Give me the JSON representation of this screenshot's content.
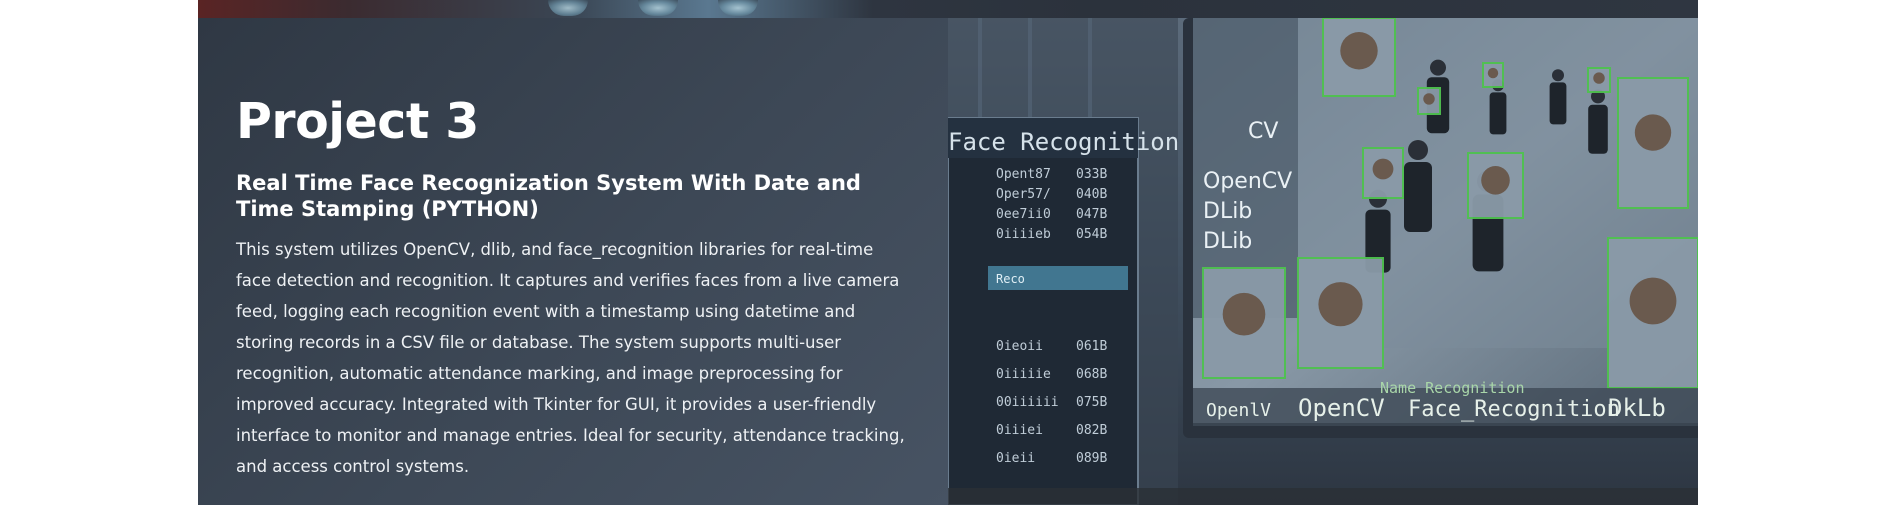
{
  "project": {
    "title": "Project 3",
    "subtitle": "Real Time Face Recognization System With Date and Time Stamping (PYTHON)",
    "description": "This system utilizes OpenCV, dlib, and face_recognition libraries for real-time face detection and recognition. It captures and verifies faces from a live camera feed, logging each recognition event with a timestamp using datetime and storing records in a CSV file or database. The system supports multi-user recognition, automatic attendance marking, and image preprocessing for improved accuracy. Integrated with Tkinter for GUI, it provides a user-friendly interface to monitor and manage entries. Ideal for security, attendance tracking, and access control systems."
  },
  "image": {
    "panel_heading": "Face Recognition",
    "side_labels": [
      "CV",
      "OpenCV",
      "DLib",
      "DLib"
    ],
    "bottom_labels": [
      "OpenlV",
      "OpenCV",
      "Face_Recognition",
      "DkLb"
    ],
    "small_label": "Reco",
    "overlay_text": "Name Recognition",
    "list_rows": [
      "Opent87",
      "Oper57/",
      "0ee7ii0",
      "0iiiieb",
      "0ieoii",
      "0iiiiie",
      "00iiiiii",
      "0iiiei",
      "0ieii"
    ],
    "accent_color": "#4fc24f"
  }
}
